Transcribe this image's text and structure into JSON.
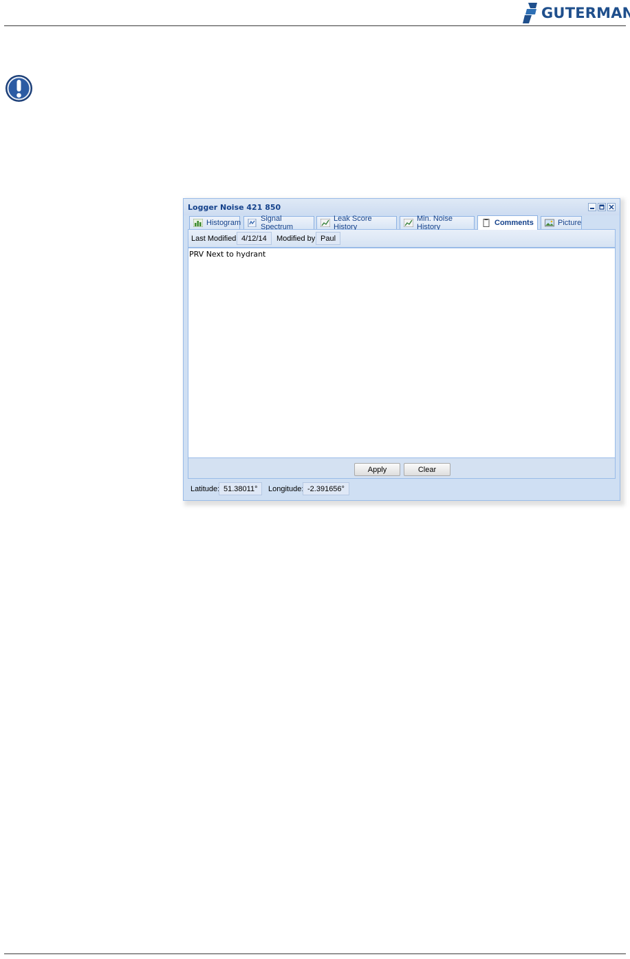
{
  "brand": {
    "name": "GUTERMANN",
    "color": "#1f4f8c"
  },
  "note_icon": "exclamation-circle-icon",
  "window": {
    "title": "Logger Noise 421 850",
    "tools": [
      "minimize-icon",
      "maximize-icon",
      "close-icon"
    ],
    "tabs": [
      {
        "label": "Histogram",
        "icon": "histogram-icon",
        "active": false
      },
      {
        "label": "Signal Spectrum",
        "icon": "spectrum-icon",
        "active": false
      },
      {
        "label": "Leak Score History",
        "icon": "line-chart-icon",
        "active": false
      },
      {
        "label": "Min. Noise History",
        "icon": "line-chart-icon",
        "active": false
      },
      {
        "label": "Comments",
        "icon": "note-icon",
        "active": true
      },
      {
        "label": "Picture",
        "icon": "picture-icon",
        "active": false
      }
    ],
    "info": {
      "last_modified_label": "Last Modified:",
      "last_modified_value": "4/12/14",
      "modified_by_label": "Modified by:",
      "modified_by_value": "Paul"
    },
    "comment_text": "PRV Next to hydrant",
    "buttons": {
      "apply": "Apply",
      "clear": "Clear"
    },
    "status": {
      "latitude_label": "Latitude:",
      "latitude_value": "51.38011°",
      "longitude_label": "Longitude:",
      "longitude_value": "-2.391656°"
    }
  }
}
